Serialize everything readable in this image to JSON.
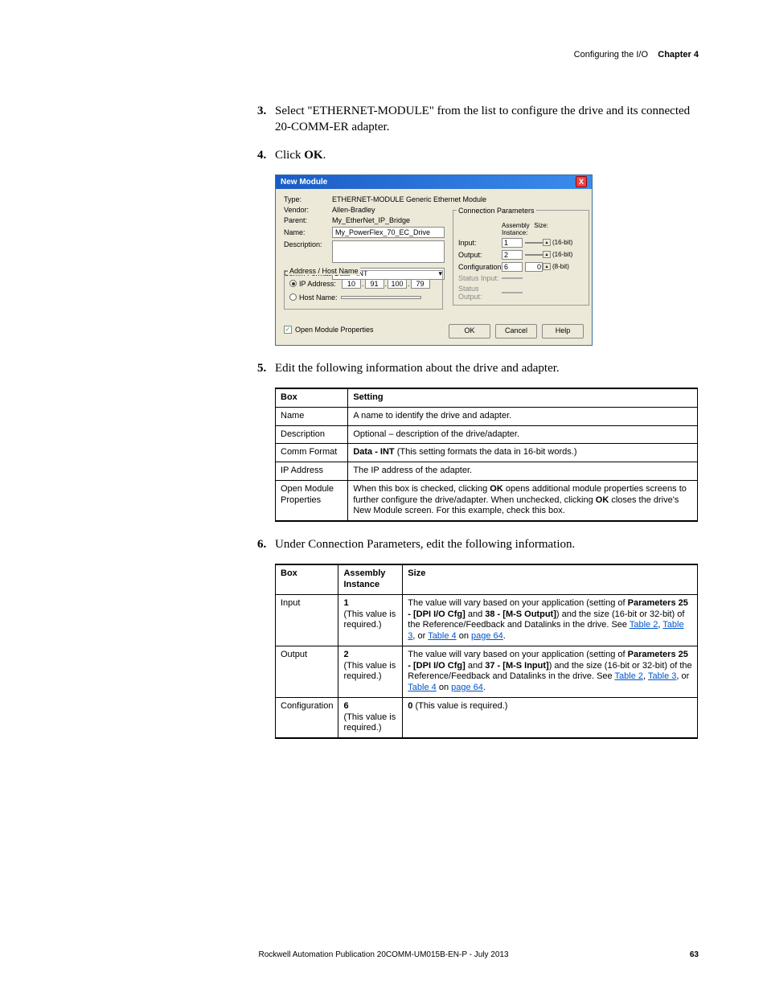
{
  "header": {
    "breadcrumb": "Configuring the I/O",
    "chapter": "Chapter 4"
  },
  "steps": {
    "s3": {
      "num": "3.",
      "text": "Select \"ETHERNET-MODULE\" from the list to configure the drive and its connected 20-COMM-ER adapter."
    },
    "s4": {
      "num": "4.",
      "text_pre": "Click ",
      "bold": "OK",
      "text_post": "."
    },
    "s5": {
      "num": "5.",
      "text": "Edit the following information about the drive and adapter."
    },
    "s6": {
      "num": "6.",
      "text": "Under Connection Parameters, edit the following information."
    }
  },
  "dialog": {
    "title": "New Module",
    "type_label": "Type:",
    "type_val": "ETHERNET-MODULE Generic Ethernet Module",
    "vendor_label": "Vendor:",
    "vendor_val": "Allen-Bradley",
    "parent_label": "Parent:",
    "parent_val": "My_EtherNet_IP_Bridge",
    "name_label": "Name:",
    "name_val": "My_PowerFlex_70_EC_Drive",
    "desc_label": "Description:",
    "desc_val": "",
    "comm_label": "Comm Format:",
    "comm_val": "Data - INT",
    "addr_group": "Address / Host Name",
    "ip_label": "IP Address:",
    "ip": [
      "10",
      "91",
      "100",
      "79"
    ],
    "host_label": "Host Name:",
    "host_val": "",
    "conn_title": "Connection Parameters",
    "assy_head": "Assembly\nInstance:",
    "size_head": "Size:",
    "rows": {
      "input": {
        "lab": "Input:",
        "assy": "1",
        "size": "",
        "unit": "(16-bit)"
      },
      "output": {
        "lab": "Output:",
        "assy": "2",
        "size": "",
        "unit": "(16-bit)"
      },
      "config": {
        "lab": "Configuration:",
        "assy": "6",
        "size": "0",
        "unit": "(8-bit)"
      },
      "sinput": {
        "lab": "Status Input:"
      },
      "soutput": {
        "lab": "Status Output:"
      }
    },
    "open_prop": "Open Module Properties",
    "ok": "OK",
    "cancel": "Cancel",
    "help": "Help"
  },
  "table1": {
    "h1": "Box",
    "h2": "Setting",
    "rows": [
      {
        "b": "Name",
        "s": "A name to identify the drive and adapter."
      },
      {
        "b": "Description",
        "s": "Optional – description of the drive/adapter."
      },
      {
        "b": "Comm Format"
      },
      {
        "b": "IP Address",
        "s": "The IP address of the adapter."
      },
      {
        "b": "Open Module Properties"
      }
    ],
    "comm_s_pre": "Data - INT ",
    "comm_s_paren": "(This setting formats the data in 16-bit words.)",
    "omp_pre": "When this box is checked, clicking ",
    "omp_b1": "OK",
    "omp_mid": " opens additional module properties screens to further configure the drive/adapter. When unchecked, clicking ",
    "omp_b2": "OK",
    "omp_post": " closes the drive's New Module screen. For this example, check this box."
  },
  "table2": {
    "h1": "Box",
    "h2": "Assembly Instance",
    "h3": "Size",
    "row_input": {
      "b": "Input",
      "a_b": "1",
      "a_t": "(This value is required.)",
      "s_pre": "The value will vary based on your application (setting of ",
      "s_b1": "Parameters 25 - [DPI I/O Cfg]",
      "s_mid1": " and ",
      "s_b2": "38 - [M-S Output]",
      "s_mid2": ") and the size (16-bit or 32-bit) of the Reference/Feedback and Datalinks in the drive. See ",
      "l1": "Table 2",
      "c1": ", ",
      "l2": "Table 3",
      "c2": ", or ",
      "l3": "Table 4",
      "c3": " on ",
      "l4": "page 64",
      "end": "."
    },
    "row_output": {
      "b": "Output",
      "a_b": "2",
      "a_t": "(This value is required.)",
      "s_pre": "The value will vary based on your application (setting of ",
      "s_b1": "Parameters 25 - [DPI I/O Cfg]",
      "s_mid1": " and ",
      "s_b2": "37 - [M-S Input]",
      "s_mid2": ") and the size (16-bit or 32-bit) of the Reference/Feedback and Datalinks in the drive. See ",
      "l1": "Table 2",
      "c1": ", ",
      "l2": "Table 3",
      "c2": ", or ",
      "l3": "Table 4",
      "c3": " on ",
      "l4": "page 64",
      "end": "."
    },
    "row_config": {
      "b": "Configuration",
      "a_b": "6",
      "a_t": "(This value is required.)",
      "s_b": "0",
      "s_post": " (This value is required.)"
    }
  },
  "footer": {
    "text": "Rockwell Automation Publication  20COMM-UM015B-EN-P - July 2013",
    "page": "63"
  }
}
